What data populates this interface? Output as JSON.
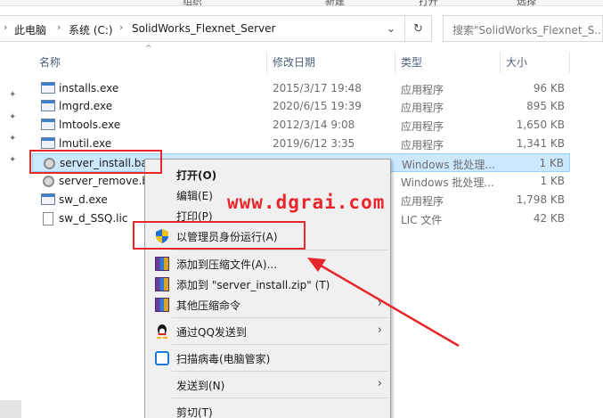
{
  "ribbon": {
    "tabs": [
      "组织",
      "新建",
      "打开",
      "选择"
    ]
  },
  "address": {
    "crumbs": [
      "此电脑",
      "系统 (C:)",
      "SolidWorks_Flexnet_Server"
    ],
    "search_placeholder": "搜索\"SolidWorks_Flexnet_S..."
  },
  "columns": {
    "name": "名称",
    "date": "修改日期",
    "type": "类型",
    "size": "大小"
  },
  "files": [
    {
      "name": "installs.exe",
      "date": "2015/3/17 19:48",
      "type": "应用程序",
      "size": "96 KB",
      "icon": "exe"
    },
    {
      "name": "lmgrd.exe",
      "date": "2020/6/15 19:39",
      "type": "应用程序",
      "size": "895 KB",
      "icon": "exe"
    },
    {
      "name": "lmtools.exe",
      "date": "2012/3/14 9:08",
      "type": "应用程序",
      "size": "1,650 KB",
      "icon": "exe"
    },
    {
      "name": "lmutil.exe",
      "date": "2019/6/12 3:35",
      "type": "应用程序",
      "size": "1,341 KB",
      "icon": "exe"
    },
    {
      "name": "server_install.bat",
      "date": "",
      "type": "Windows 批处理...",
      "size": "1 KB",
      "icon": "bat"
    },
    {
      "name": "server_remove.b",
      "date": "",
      "type": "Windows 批处理...",
      "size": "1 KB",
      "icon": "bat"
    },
    {
      "name": "sw_d.exe",
      "date": "",
      "type": "应用程序",
      "size": "1,798 KB",
      "icon": "exe"
    },
    {
      "name": "sw_d_SSQ.lic",
      "date": "",
      "type": "LIC 文件",
      "size": "42 KB",
      "icon": "doc"
    }
  ],
  "watermark": "www.dgrai.com",
  "context_menu": {
    "open": "打开(O)",
    "edit": "编辑(E)",
    "print": "打印(P)",
    "run_as_admin": "以管理员身份运行(A)",
    "add_to_archive": "添加到压缩文件(A)...",
    "add_to_zip": "添加到 \"server_install.zip\" (T)",
    "more_compress": "其他压缩命令",
    "send_via_qq": "通过QQ发送到",
    "scan_virus": "扫描病毒(电脑管家)",
    "send_to": "发送到(N)",
    "cut": "剪切(T)"
  },
  "colors": {
    "annotation_red": "#e8262b",
    "selection_bg": "#cce8ff",
    "menu_bg": "#f0f0f0"
  }
}
